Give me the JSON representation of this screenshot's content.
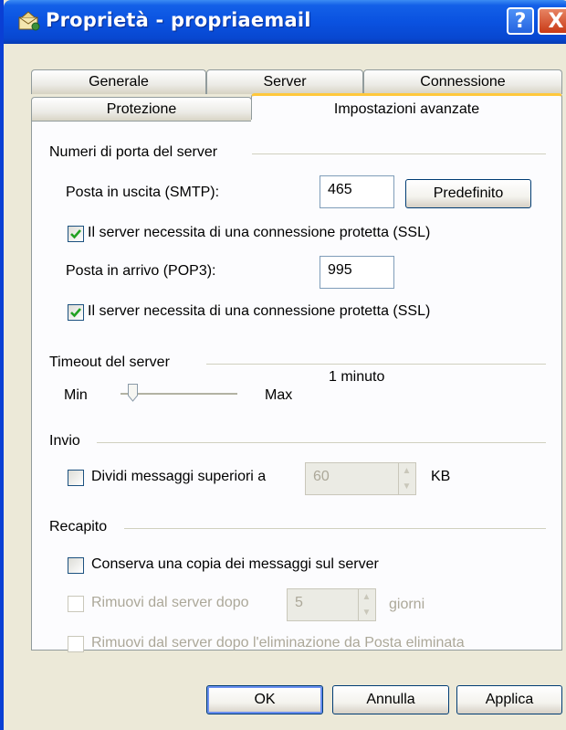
{
  "window": {
    "title": "Proprietà - propriaemail",
    "help": "?",
    "close": "X"
  },
  "tabs": {
    "row_back": [
      "Generale",
      "Server",
      "Connessione"
    ],
    "row_front": [
      "Protezione",
      "Impostazioni avanzate"
    ]
  },
  "ports": {
    "group": "Numeri di porta del server",
    "smtp_label": "Posta in uscita (SMTP):",
    "smtp_value": "465",
    "default_button": "Predefinito",
    "smtp_ssl_label": "Il server necessita di una connessione protetta (SSL)",
    "smtp_ssl_checked": true,
    "pop3_label": "Posta in arrivo (POP3):",
    "pop3_value": "995",
    "pop3_ssl_label": "Il server necessita di una connessione protetta (SSL)",
    "pop3_ssl_checked": true
  },
  "timeout": {
    "group": "Timeout del server",
    "min": "Min",
    "max": "Max",
    "value_label": "1 minuto",
    "level": 0.1
  },
  "sending": {
    "group": "Invio",
    "split_label": "Dividi messaggi superiori a",
    "split_checked": false,
    "split_value": "60",
    "unit": "KB"
  },
  "delivery": {
    "group": "Recapito",
    "keep_copy_label": "Conserva una copia dei messaggi sul server",
    "keep_copy_checked": false,
    "remove_after_label": "Rimuovi dal server dopo",
    "remove_after_value": "5",
    "remove_after_unit": "giorni",
    "remove_deleted_label": "Rimuovi dal server dopo l'eliminazione da Posta eliminata"
  },
  "footer": {
    "ok": "OK",
    "cancel": "Annulla",
    "apply": "Applica"
  }
}
